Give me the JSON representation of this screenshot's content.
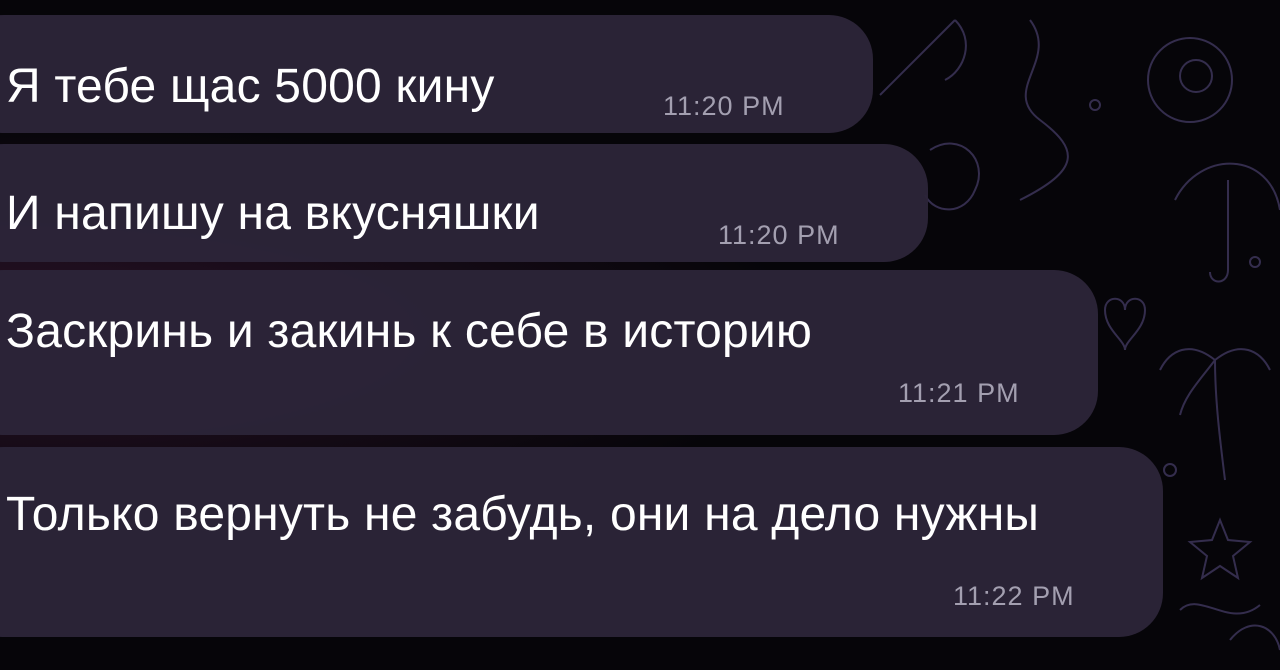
{
  "messages": [
    {
      "text": "Я тебе щас 5000 кину",
      "time": "11:20 PM"
    },
    {
      "text": "И напишу на вкусняшки",
      "time": "11:20 PM"
    },
    {
      "text": "Заскринь и закинь к себе в историю",
      "time": "11:21 PM"
    },
    {
      "text": "Только вернуть не забудь, они на дело нужны",
      "time": "11:22 PM"
    }
  ],
  "colors": {
    "bubble": "#2c2438",
    "text": "#ffffff",
    "time": "#a39fb0",
    "background": "#060509"
  }
}
